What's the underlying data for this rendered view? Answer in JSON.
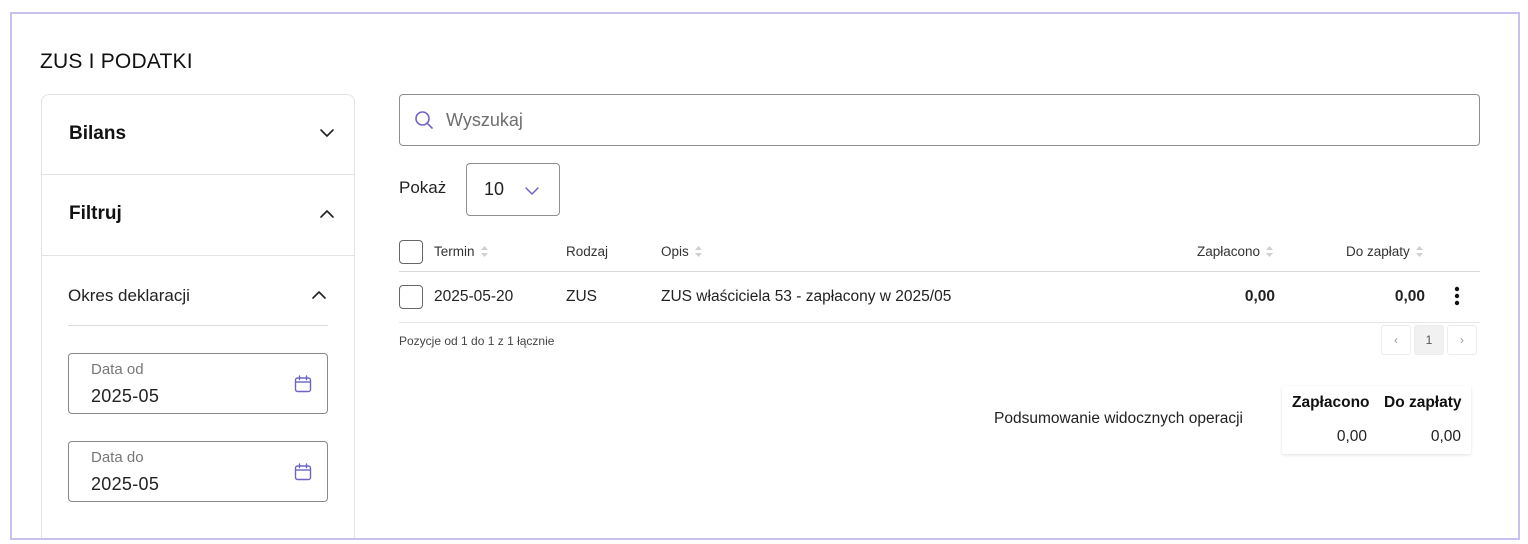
{
  "page": {
    "title": "ZUS I PODATKI"
  },
  "sidebar": {
    "bilans_label": "Bilans",
    "filter_label": "Filtruj",
    "period_label": "Okres deklaracji",
    "date_from": {
      "label": "Data od",
      "value": "2025-05"
    },
    "date_to": {
      "label": "Data do",
      "value": "2025-05"
    }
  },
  "search": {
    "placeholder": "Wyszukaj"
  },
  "page_size": {
    "label": "Pokaż",
    "value": "10"
  },
  "table": {
    "headers": {
      "termin": "Termin",
      "rodzaj": "Rodzaj",
      "opis": "Opis",
      "zaplacono": "Zapłacono",
      "do_zaplaty": "Do zapłaty"
    },
    "rows": [
      {
        "termin": "2025-05-20",
        "rodzaj": "ZUS",
        "opis": "ZUS właściciela 53 - zapłacony w 2025/05",
        "zaplacono": "0,00",
        "do_zaplaty": "0,00"
      }
    ]
  },
  "pagination": {
    "range_text": "Pozycje od 1 do 1 z 1 łącznie",
    "current_page": "1",
    "prev": "‹",
    "next": "›"
  },
  "summary": {
    "label": "Podsumowanie widocznych operacji",
    "zaplacono_header": "Zapłacono",
    "do_zaplaty_header": "Do zapłaty",
    "zaplacono_value": "0,00",
    "do_zaplaty_value": "0,00"
  },
  "colors": {
    "accent": "#6f63c4",
    "frame": "#c9c2ee",
    "text": "#1f1f1f"
  }
}
